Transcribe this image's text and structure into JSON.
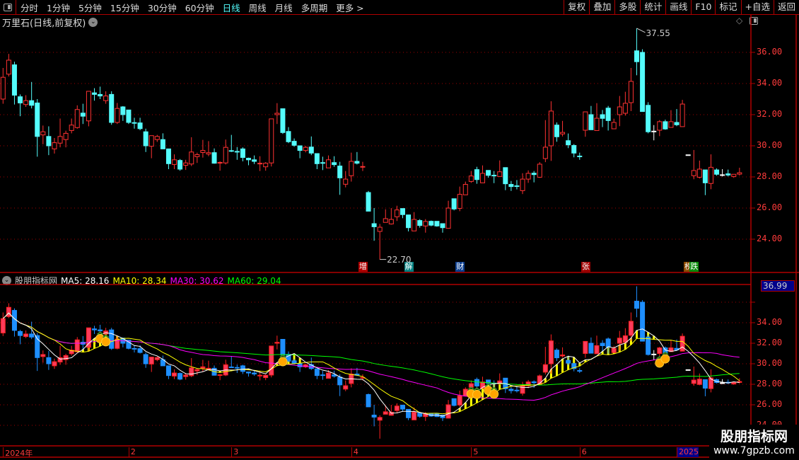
{
  "toolbar": {
    "items": [
      "分时",
      "1分钟",
      "5分钟",
      "15分钟",
      "30分钟",
      "60分钟",
      "日线",
      "周线",
      "月线",
      "多周期",
      "更多 >"
    ],
    "active": "日线",
    "right_buttons": [
      "复权",
      "叠加",
      "多股",
      "统计",
      "画线",
      "F10",
      "标记",
      "+自选",
      "返回"
    ]
  },
  "title": "万里石(日线,前复权)",
  "indicator": {
    "name": "股朋指标网",
    "ma5": "MA5: 28.16",
    "ma10": "MA10: 28.34",
    "ma30": "MA30: 30.62",
    "ma60": "MA60: 29.04",
    "current": "36.99"
  },
  "colors": {
    "up": "#ff3232",
    "down": "#54fcfc",
    "down_lower": "#1e8fff",
    "up_lower": "#ff3a5a",
    "ma5": "#ffffff",
    "ma10": "#ffff00",
    "ma30": "#ff00ff",
    "ma60": "#00ff00"
  },
  "annotations": {
    "high": "37.55",
    "low": "22.70"
  },
  "events": [
    {
      "label": "增",
      "color": "#b00000",
      "index": 63
    },
    {
      "label": "解",
      "color": "#008080",
      "index": 71
    },
    {
      "label": "财",
      "color": "#0a3d8f",
      "index": 80
    },
    {
      "label": "张",
      "color": "#a00000",
      "index": 102
    },
    {
      "label": "榜",
      "color": "#8b4a00",
      "index": 120
    },
    {
      "label": "跌",
      "color": "#0a8a0a",
      "index": 121
    }
  ],
  "axis_top": [
    "36.00",
    "34.00",
    "32.00",
    "30.00",
    "28.00",
    "26.00",
    "24.00"
  ],
  "axis_bottom": [
    "36.00",
    "34.00",
    "32.00",
    "30.00",
    "28.00",
    "26.00",
    "24.00"
  ],
  "dates": [
    {
      "label": "2024年",
      "index": 0
    },
    {
      "label": "2",
      "index": 22
    },
    {
      "label": "3",
      "index": 40
    },
    {
      "label": "4",
      "index": 61
    },
    {
      "label": "5",
      "index": 82
    },
    {
      "label": "6",
      "index": 101
    },
    {
      "label": "2025",
      "index": 118
    }
  ],
  "watermark": {
    "name": "股朋指标网",
    "url": "www.7gpzb.com"
  },
  "signals": [
    17,
    18,
    49,
    82,
    83,
    85,
    86,
    115,
    116
  ],
  "chart_data": {
    "type": "candlestick",
    "fields": [
      "open",
      "high",
      "low",
      "close"
    ],
    "candles": [
      [
        33.0,
        35.0,
        32.7,
        34.4
      ],
      [
        34.6,
        35.9,
        34.45,
        35.5
      ],
      [
        35.2,
        35.4,
        32.65,
        33.25
      ],
      [
        33.15,
        33.3,
        31.9,
        32.75
      ],
      [
        32.65,
        33.25,
        32.5,
        32.9
      ],
      [
        32.9,
        34.1,
        32.4,
        32.6
      ],
      [
        32.75,
        33.0,
        29.3,
        30.6
      ],
      [
        30.7,
        31.3,
        30.1,
        30.9
      ],
      [
        30.6,
        31.25,
        29.4,
        30.0
      ],
      [
        29.8,
        30.5,
        29.5,
        30.2
      ],
      [
        30.17,
        31.75,
        29.9,
        30.6
      ],
      [
        30.4,
        30.97,
        29.9,
        30.8
      ],
      [
        30.98,
        31.75,
        30.8,
        31.33
      ],
      [
        31.17,
        32.6,
        31.1,
        32.33
      ],
      [
        32.1,
        32.7,
        31.4,
        31.9
      ],
      [
        31.6,
        33.5,
        31.25,
        33.5
      ],
      [
        33.4,
        33.7,
        32.9,
        33.3
      ],
      [
        33.3,
        33.8,
        33.0,
        33.2
      ],
      [
        32.9,
        33.5,
        32.7,
        33.2
      ],
      [
        33.3,
        33.5,
        31.35,
        31.5
      ],
      [
        31.5,
        32.75,
        31.4,
        32.4
      ],
      [
        32.5,
        32.55,
        31.6,
        32.0
      ],
      [
        32.3,
        32.3,
        31.4,
        31.5
      ],
      [
        31.49,
        31.8,
        31.1,
        31.47
      ],
      [
        31.47,
        31.8,
        31.0,
        31.1
      ],
      [
        30.9,
        31.1,
        29.6,
        30.0
      ],
      [
        29.97,
        30.65,
        29.2,
        30.65
      ],
      [
        30.4,
        30.7,
        30.25,
        30.6
      ],
      [
        30.4,
        30.8,
        29.8,
        29.8
      ],
      [
        29.8,
        29.8,
        28.5,
        28.85
      ],
      [
        28.8,
        29.45,
        28.5,
        29.1
      ],
      [
        29.06,
        29.15,
        28.4,
        28.5
      ],
      [
        28.75,
        29.1,
        28.45,
        28.9
      ],
      [
        28.83,
        30.55,
        28.7,
        29.6
      ],
      [
        29.3,
        29.56,
        28.9,
        29.43
      ],
      [
        29.57,
        30.38,
        29.24,
        29.7
      ],
      [
        29.47,
        30.3,
        29.33,
        29.56
      ],
      [
        29.56,
        29.83,
        28.85,
        28.88
      ],
      [
        28.9,
        29.0,
        28.4,
        28.93
      ],
      [
        28.9,
        30.4,
        28.8,
        29.9
      ],
      [
        29.69,
        30.7,
        29.6,
        29.67
      ],
      [
        29.64,
        29.92,
        29.1,
        29.62
      ],
      [
        29.8,
        29.9,
        29.0,
        29.25
      ],
      [
        29.2,
        29.24,
        28.75,
        29.1
      ],
      [
        29.1,
        29.38,
        28.83,
        29.0
      ],
      [
        28.86,
        29.33,
        28.38,
        28.88
      ],
      [
        28.65,
        28.95,
        28.4,
        28.88
      ],
      [
        28.9,
        31.73,
        28.67,
        31.73
      ],
      [
        32.0,
        32.74,
        31.4,
        32.09
      ],
      [
        32.38,
        32.38,
        30.76,
        30.85
      ],
      [
        30.92,
        31.2,
        30.17,
        30.26
      ],
      [
        30.29,
        30.47,
        29.94,
        30.03
      ],
      [
        30.0,
        30.0,
        29.2,
        29.7
      ],
      [
        29.7,
        30.0,
        29.58,
        29.9
      ],
      [
        29.92,
        30.6,
        29.4,
        29.53
      ],
      [
        29.5,
        29.5,
        28.5,
        28.85
      ],
      [
        28.92,
        29.3,
        28.44,
        28.9
      ],
      [
        28.58,
        29.38,
        28.58,
        29.1
      ],
      [
        28.92,
        29.33,
        28.65,
        28.79
      ],
      [
        28.7,
        28.97,
        26.85,
        27.94
      ],
      [
        27.53,
        28.38,
        27.33,
        27.86
      ],
      [
        28.08,
        29.56,
        27.7,
        29.0
      ],
      [
        29.0,
        29.6,
        28.8,
        28.88
      ],
      [
        28.65,
        28.97,
        28.38,
        28.67
      ],
      [
        27.0,
        27.1,
        25.8,
        25.8
      ],
      [
        25.0,
        26.0,
        23.9,
        24.8
      ],
      [
        24.5,
        24.98,
        22.7,
        24.77
      ],
      [
        25.08,
        25.92,
        25.08,
        25.32
      ],
      [
        24.98,
        26.0,
        24.94,
        25.27
      ],
      [
        25.44,
        26.15,
        25.17,
        25.88
      ],
      [
        25.97,
        25.97,
        25.35,
        25.58
      ],
      [
        25.56,
        25.56,
        24.5,
        24.74
      ],
      [
        24.53,
        25.74,
        24.53,
        25.27
      ],
      [
        25.2,
        25.29,
        24.74,
        24.88
      ],
      [
        24.85,
        25.29,
        24.42,
        25.14
      ],
      [
        25.15,
        25.2,
        24.83,
        24.9
      ],
      [
        25.15,
        25.15,
        24.8,
        24.85
      ],
      [
        25.0,
        25.0,
        24.42,
        24.74
      ],
      [
        24.7,
        26.47,
        24.68,
        26.0
      ],
      [
        26.6,
        26.6,
        25.85,
        25.94
      ],
      [
        25.98,
        27.38,
        25.8,
        26.88
      ],
      [
        26.85,
        27.7,
        26.85,
        27.52
      ],
      [
        27.71,
        28.38,
        27.62,
        28.06
      ],
      [
        28.47,
        28.65,
        27.56,
        27.83
      ],
      [
        27.62,
        28.74,
        27.62,
        28.23
      ],
      [
        28.42,
        28.42,
        27.95,
        28.1
      ],
      [
        28.11,
        28.38,
        27.6,
        28.09
      ],
      [
        28.03,
        29.06,
        28.03,
        28.33
      ],
      [
        28.6,
        28.6,
        27.15,
        27.56
      ],
      [
        27.52,
        27.74,
        27.1,
        27.38
      ],
      [
        27.43,
        27.8,
        27.2,
        27.41
      ],
      [
        27.12,
        28.24,
        26.9,
        27.86
      ],
      [
        27.86,
        28.42,
        27.62,
        28.23
      ],
      [
        28.24,
        28.38,
        27.65,
        28.15
      ],
      [
        27.98,
        28.95,
        27.94,
        28.82
      ],
      [
        29.18,
        31.65,
        28.95,
        29.91
      ],
      [
        30.0,
        32.86,
        29.03,
        32.23
      ],
      [
        31.33,
        31.5,
        30.26,
        30.58
      ],
      [
        30.76,
        31.6,
        30.6,
        30.86
      ],
      [
        30.33,
        30.79,
        29.85,
        30.06
      ],
      [
        30.02,
        30.11,
        29.26,
        29.53
      ],
      [
        29.34,
        29.56,
        29.1,
        29.32
      ],
      [
        31.0,
        32.18,
        30.58,
        32.18
      ],
      [
        32.0,
        32.56,
        31.03,
        31.03
      ],
      [
        30.98,
        32.74,
        30.98,
        31.77
      ],
      [
        32.0,
        32.3,
        31.2,
        31.76
      ],
      [
        32.42,
        32.56,
        30.98,
        31.62
      ],
      [
        31.09,
        31.74,
        31.09,
        31.5
      ],
      [
        32.0,
        33.2,
        31.26,
        32.5
      ],
      [
        32.09,
        33.47,
        31.94,
        32.73
      ],
      [
        32.77,
        35.0,
        32.23,
        34.14
      ],
      [
        36.1,
        37.55,
        34.53,
        35.4
      ],
      [
        36.0,
        36.2,
        32.2,
        32.2
      ],
      [
        32.6,
        32.8,
        30.8,
        30.9
      ],
      [
        30.94,
        31.33,
        30.35,
        30.94
      ],
      [
        31.0,
        31.65,
        30.62,
        31.55
      ],
      [
        31.55,
        31.68,
        31.03,
        31.08
      ],
      [
        31.18,
        32.29,
        31.18,
        31.55
      ],
      [
        31.5,
        32.36,
        31.26,
        31.35
      ],
      [
        31.23,
        32.95,
        31.23,
        32.68
      ],
      [
        29.42,
        29.42,
        29.42,
        29.42
      ],
      [
        28.08,
        29.73,
        27.85,
        28.41
      ],
      [
        27.98,
        29.05,
        27.9,
        28.5
      ],
      [
        28.45,
        28.45,
        26.83,
        27.62
      ],
      [
        27.58,
        29.45,
        27.21,
        28.62
      ],
      [
        28.45,
        28.55,
        28.08,
        28.17
      ],
      [
        28.14,
        28.5,
        28.03,
        28.14
      ],
      [
        28.2,
        28.47,
        28.03,
        28.12
      ],
      [
        28.03,
        28.17,
        27.94,
        28.17
      ],
      [
        28.18,
        28.59,
        28.09,
        28.27
      ]
    ],
    "yrange_top": [
      24,
      36
    ],
    "yrange_bottom": [
      24,
      36
    ]
  }
}
